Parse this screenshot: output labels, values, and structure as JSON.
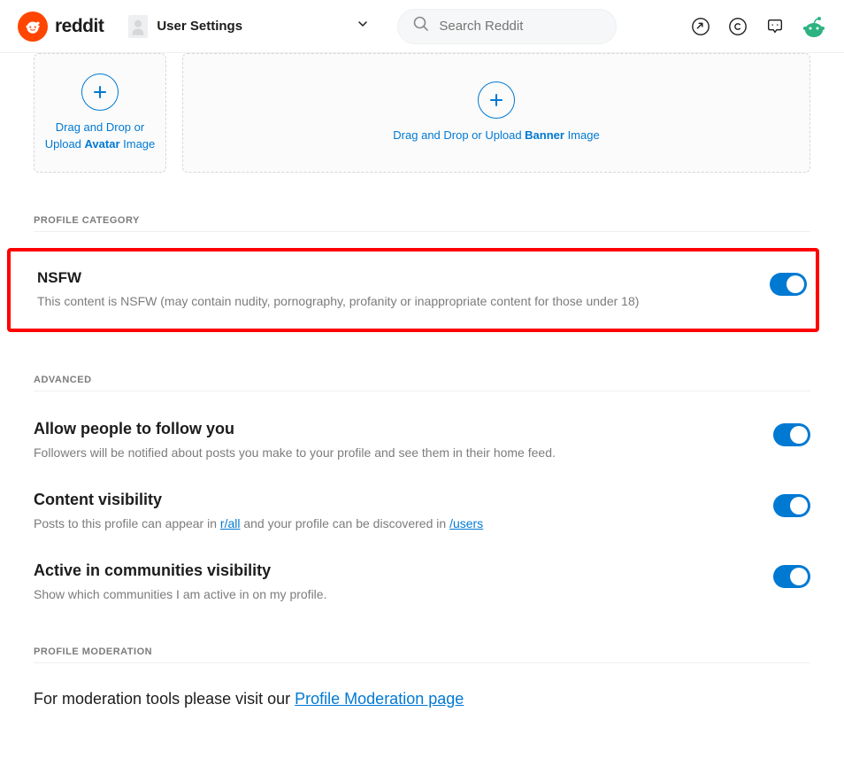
{
  "header": {
    "brand": "reddit",
    "nav_label": "User Settings",
    "search_placeholder": "Search Reddit"
  },
  "uploads": {
    "avatar_prefix": "Drag and Drop or Upload ",
    "avatar_bold": "Avatar",
    "avatar_suffix": " Image",
    "banner_prefix": "Drag and Drop or Upload ",
    "banner_bold": "Banner",
    "banner_suffix": " Image"
  },
  "sections": {
    "profile_category": "PROFILE CATEGORY",
    "advanced": "ADVANCED",
    "profile_moderation": "PROFILE MODERATION"
  },
  "settings": {
    "nsfw": {
      "title": "NSFW",
      "desc": "This content is NSFW (may contain nudity, pornography, profanity or inappropriate content for those under 18)",
      "on": true
    },
    "follow": {
      "title": "Allow people to follow you",
      "desc": "Followers will be notified about posts you make to your profile and see them in their home feed.",
      "on": true
    },
    "content_visibility": {
      "title": "Content visibility",
      "desc_pre": "Posts to this profile can appear in ",
      "link1": "r/all",
      "desc_mid": " and your profile can be discovered in ",
      "link2": "/users",
      "on": true
    },
    "active_communities": {
      "title": "Active in communities visibility",
      "desc": "Show which communities I am active in on my profile.",
      "on": true
    }
  },
  "moderation": {
    "text_pre": "For moderation tools please visit our ",
    "link": "Profile Moderation page"
  }
}
